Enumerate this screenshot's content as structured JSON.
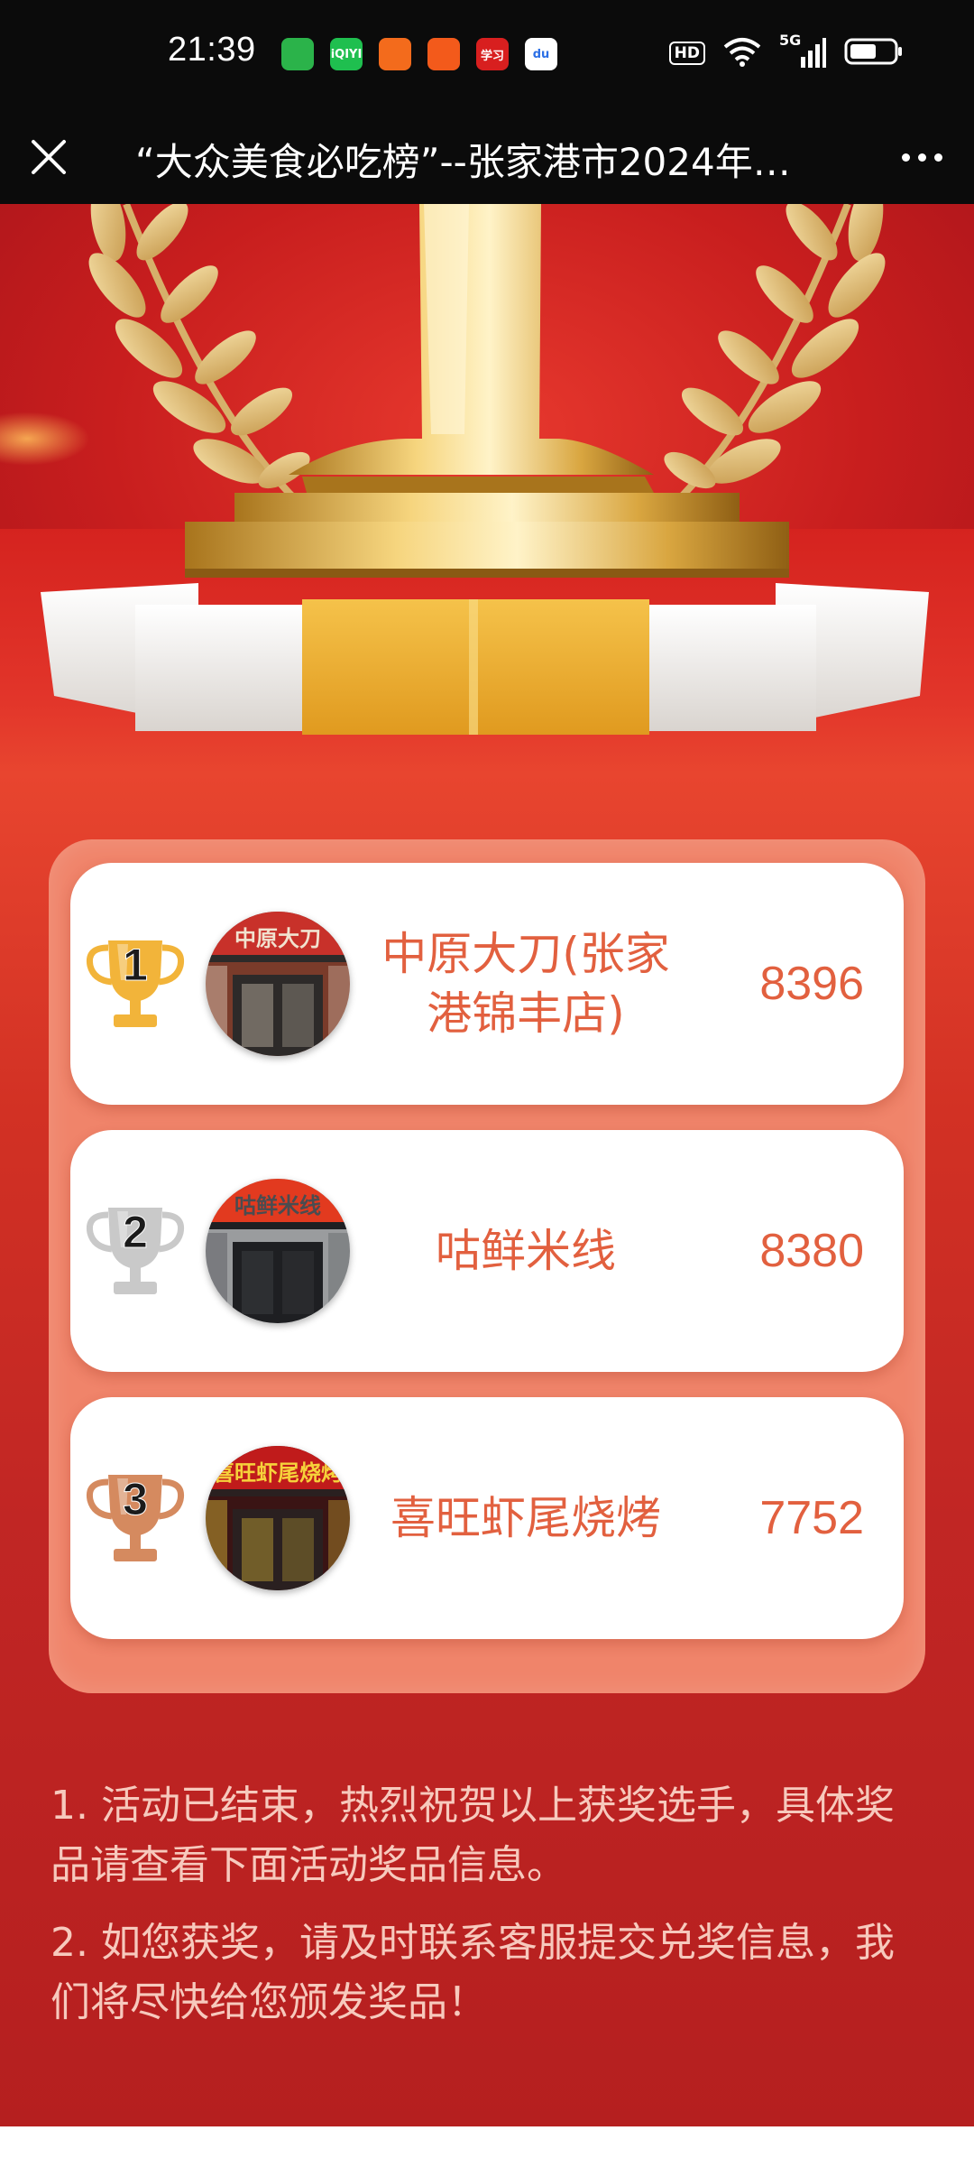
{
  "status_bar": {
    "time": "21:39",
    "notifications": [
      {
        "icon": "messages-app-icon",
        "label": "",
        "color": "#2bb34a"
      },
      {
        "icon": "iqiyi-app-icon",
        "label": "iQIYI",
        "color": "#1fbf4f"
      },
      {
        "icon": "app-person-icon",
        "label": "",
        "color": "#f36b1c"
      },
      {
        "icon": "kuaishou-app-icon",
        "label": "",
        "color": "#f35a1b"
      },
      {
        "icon": "xuexi-app-icon",
        "label": "学习",
        "color": "#d81f1f"
      },
      {
        "icon": "baidu-app-icon",
        "label": "du",
        "color": "#ffffff"
      }
    ],
    "hd": "HD",
    "network": "5G"
  },
  "title_bar": {
    "title": "“大众美食必吃榜”--张家港市2024年…"
  },
  "rankings": [
    {
      "rank": "1",
      "cup_color": "#f2b43a",
      "name": "中原大刀(张家港锦丰店)",
      "votes": "8396",
      "photo_sign": "中原大刀"
    },
    {
      "rank": "2",
      "cup_color": "#c9c9c9",
      "name": "咕鲜米线",
      "votes": "8380",
      "photo_sign": "咕鲜米线"
    },
    {
      "rank": "3",
      "cup_color": "#d58a5f",
      "name": "喜旺虾尾烧烤",
      "votes": "7752",
      "photo_sign": "喜旺虾尾烧烤"
    }
  ],
  "notes": [
    "1. 活动已结束，热烈祝贺以上获奖选手，具体奖品请查看下面活动奖品信息。",
    "2. 如您获奖，请及时联系客服提交兑奖信息，我们将尽快给您颁发奖品！"
  ]
}
